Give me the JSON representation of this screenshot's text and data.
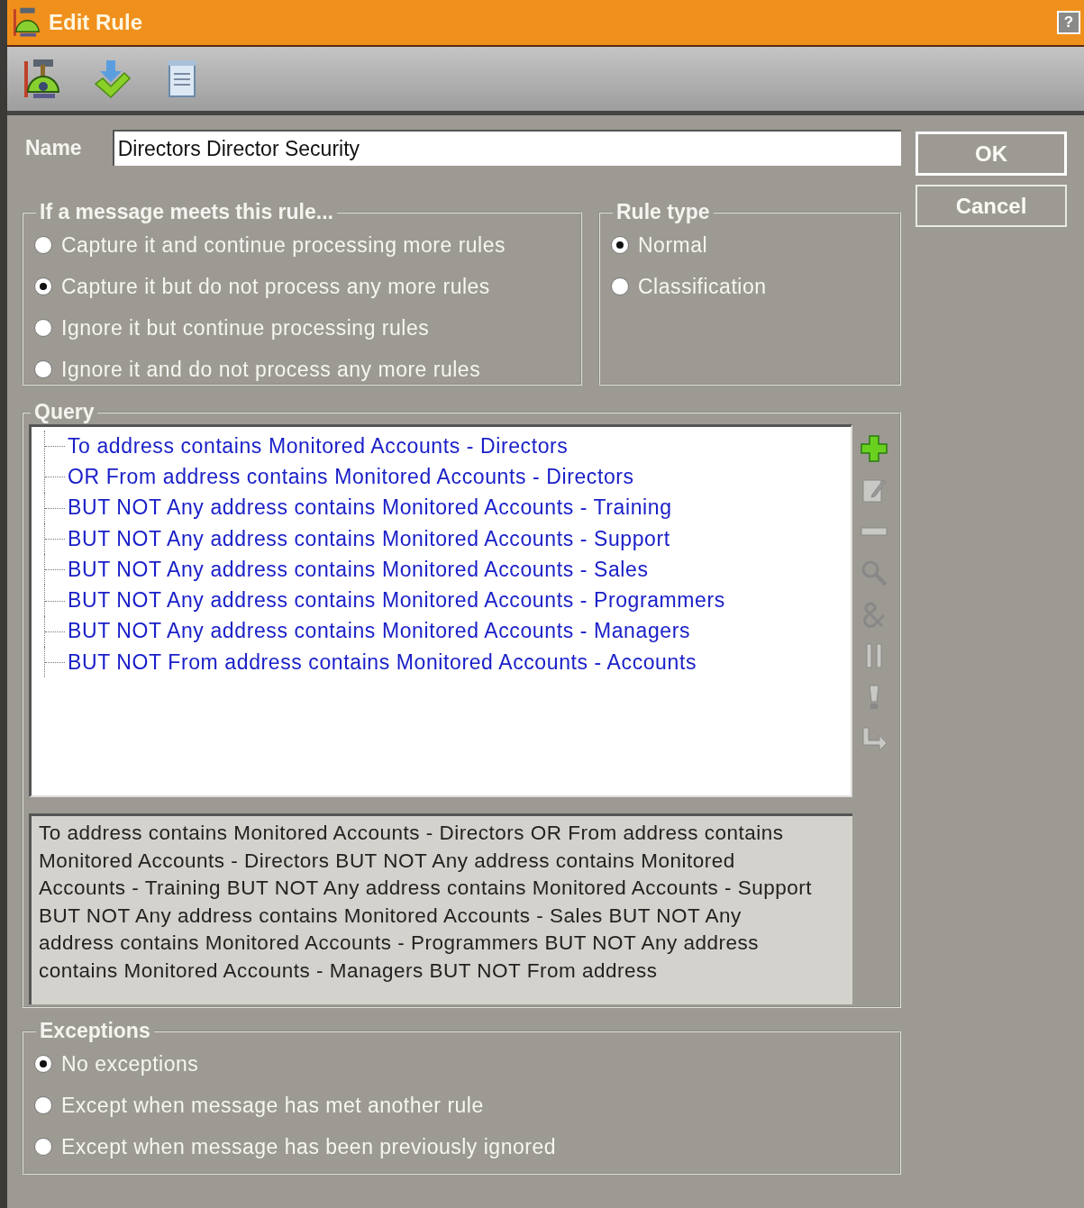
{
  "window": {
    "title": "Edit Rule",
    "help_button": "?"
  },
  "toolbar": [
    {
      "kind": "tools"
    },
    {
      "kind": "apply"
    },
    {
      "kind": "document"
    }
  ],
  "name_field": {
    "label": "Name",
    "value": "Directors Director Security"
  },
  "buttons": [
    {
      "label": "OK",
      "default": true
    },
    {
      "label": "Cancel",
      "default": false
    }
  ],
  "action_group": {
    "title": "If a message meets this rule...",
    "options": [
      {
        "label": "Capture it and continue processing more rules",
        "selected": false
      },
      {
        "label": "Capture it but do not process any more rules",
        "selected": true
      },
      {
        "label": "Ignore it but continue processing rules",
        "selected": false
      },
      {
        "label": "Ignore it and do not process any more rules",
        "selected": false
      }
    ]
  },
  "rule_type": {
    "title": "Rule type",
    "options": [
      {
        "label": "Normal",
        "selected": true
      },
      {
        "label": "Classification",
        "selected": false
      }
    ]
  },
  "query": {
    "title": "Query",
    "conditions": [
      "To address contains Monitored Accounts - Directors",
      "OR From address contains Monitored Accounts - Directors",
      "BUT NOT Any address contains Monitored Accounts - Training",
      "BUT NOT Any address contains Monitored Accounts - Support",
      "BUT NOT Any address contains Monitored Accounts - Sales",
      "BUT NOT Any address contains Monitored Accounts - Programmers",
      "BUT NOT Any address contains Monitored Accounts - Managers",
      "BUT NOT From address contains Monitored Accounts - Accounts"
    ],
    "tools": [
      {
        "kind": "add",
        "disabled": false
      },
      {
        "kind": "edit",
        "disabled": true
      },
      {
        "kind": "remove",
        "disabled": true
      },
      {
        "kind": "search",
        "disabled": true
      },
      {
        "kind": "and",
        "disabled": true
      },
      {
        "kind": "or",
        "disabled": true
      },
      {
        "kind": "not",
        "disabled": true
      },
      {
        "kind": "indent",
        "disabled": true
      }
    ],
    "description": "To address contains Monitored Accounts - Directors OR From address contains Monitored Accounts - Directors BUT NOT Any address contains Monitored Accounts - Training BUT NOT Any address contains Monitored Accounts - Support BUT NOT Any address contains Monitored Accounts - Sales BUT NOT Any address contains Monitored Accounts - Programmers BUT NOT Any address contains Monitored Accounts - Managers BUT NOT From address"
  },
  "exceptions": {
    "title": "Exceptions",
    "options": [
      {
        "label": "No exceptions",
        "selected": true
      },
      {
        "label": "Except when message has met another rule",
        "selected": false
      },
      {
        "label": "Except when message has been previously ignored",
        "selected": false
      }
    ]
  }
}
